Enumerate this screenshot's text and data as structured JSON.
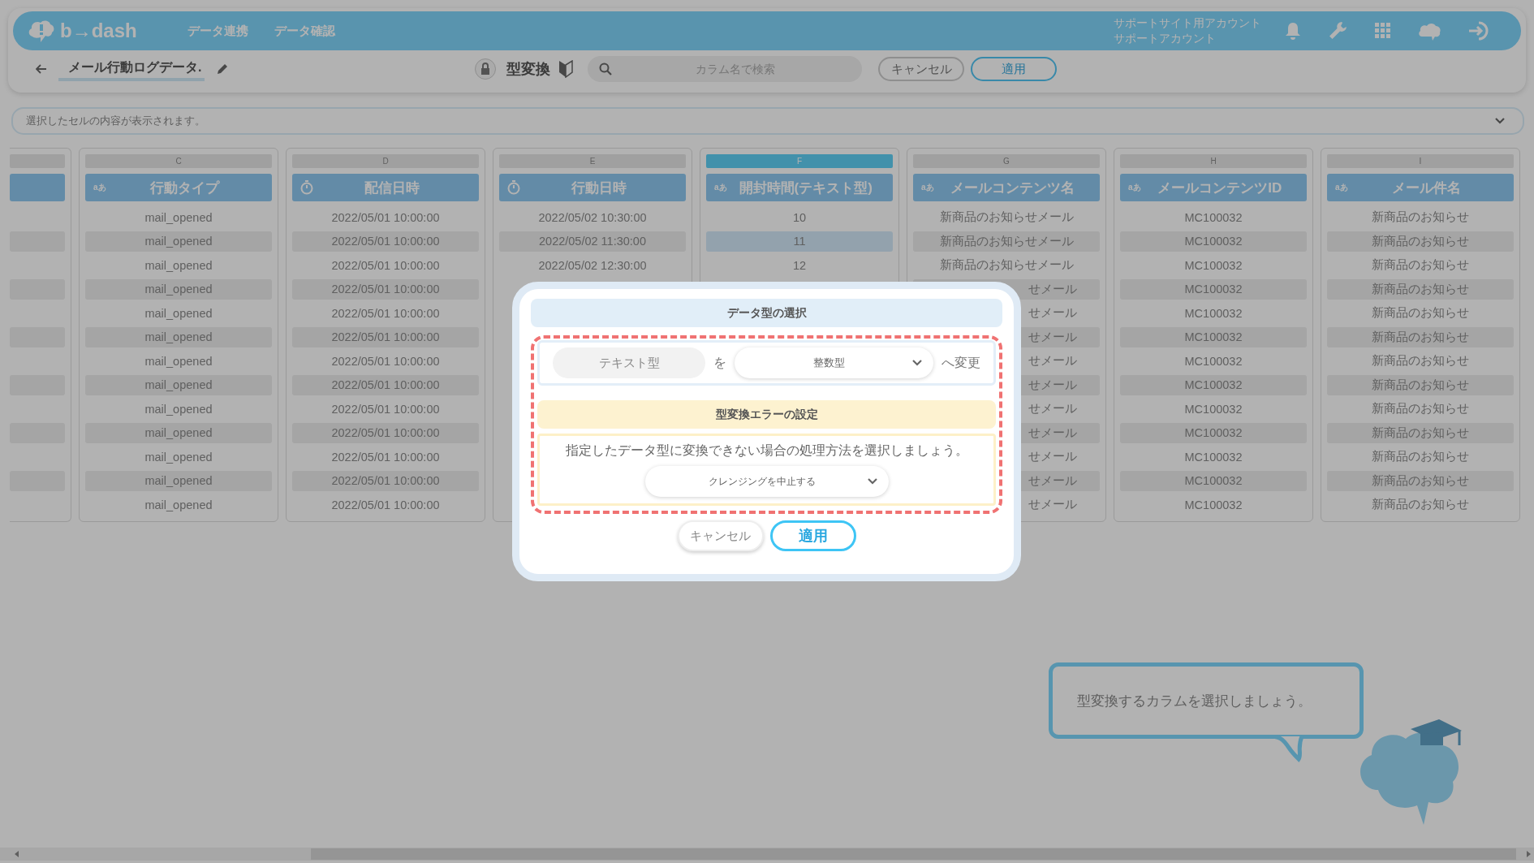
{
  "header": {
    "logo_text": "b→dash",
    "nav": [
      "データ連携",
      "データ確認"
    ],
    "account_lines": [
      "サポートサイト用アカウント",
      "サポートアカウント"
    ]
  },
  "toolbar": {
    "title": "メール行動ログデータ.",
    "mode_label": "型変換",
    "search": {
      "placeholder": "カラム名で検索"
    },
    "buttons": [
      {
        "label": "キャンセル",
        "kind": "secondary"
      },
      {
        "label": "適用",
        "kind": "primary"
      }
    ]
  },
  "cell_preview": {
    "placeholder": "選択したセルの内容が表示されます。"
  },
  "table": {
    "columns": [
      {
        "letter": "C",
        "name": "行動タイプ",
        "kind": "text",
        "type_mark": "aあ",
        "selected": false,
        "cells": [
          {
            "text": "mail_opened"
          },
          {
            "text": "mail_opened"
          },
          {
            "text": "mail_opened"
          },
          {
            "text": "mail_opened"
          },
          {
            "text": "mail_opened"
          },
          {
            "text": "mail_opened"
          },
          {
            "text": "mail_opened"
          },
          {
            "text": "mail_opened"
          },
          {
            "text": "mail_opened"
          },
          {
            "text": "mail_opened"
          },
          {
            "text": "mail_opened"
          },
          {
            "text": "mail_opened"
          },
          {
            "text": "mail_opened"
          }
        ]
      },
      {
        "letter": "D",
        "name": "配信日時",
        "kind": "datetime",
        "selected": false,
        "cells": [
          {
            "text": "2022/05/01 10:00:00"
          },
          {
            "text": "2022/05/01 10:00:00"
          },
          {
            "text": "2022/05/01 10:00:00"
          },
          {
            "text": "2022/05/01 10:00:00"
          },
          {
            "text": "2022/05/01 10:00:00"
          },
          {
            "text": "2022/05/01 10:00:00"
          },
          {
            "text": "2022/05/01 10:00:00"
          },
          {
            "text": "2022/05/01 10:00:00"
          },
          {
            "text": "2022/05/01 10:00:00"
          },
          {
            "text": "2022/05/01 10:00:00"
          },
          {
            "text": "2022/05/01 10:00:00"
          },
          {
            "text": "2022/05/01 10:00:00"
          },
          {
            "text": "2022/05/01 10:00:00"
          }
        ]
      },
      {
        "letter": "E",
        "name": "行動日時",
        "kind": "datetime",
        "selected": false,
        "cells": [
          {
            "text": "2022/05/02 10:30:00"
          },
          {
            "text": "2022/05/02 11:30:00"
          },
          {
            "text": "2022/05/02 12:30:00"
          }
        ]
      },
      {
        "letter": "F",
        "name": "開封時間(テキスト型)",
        "kind": "text",
        "type_mark": "aあ",
        "selected": true,
        "cells": [
          {
            "text": "10",
            "selected": false
          },
          {
            "text": "11",
            "selected": true
          },
          {
            "text": "12",
            "selected": false
          }
        ]
      },
      {
        "letter": "G",
        "name": "メールコンテンツ名",
        "kind": "text",
        "type_mark": "aあ",
        "selected": false,
        "cells": [
          {
            "text": "新商品のお知らせメール"
          },
          {
            "text": "新商品のお知らせメール"
          },
          {
            "text": "新商品のお知らせメール"
          },
          {
            "text": "せメール",
            "partial": true
          },
          {
            "text": "せメール",
            "partial": true
          },
          {
            "text": "せメール",
            "partial": true
          },
          {
            "text": "せメール",
            "partial": true
          },
          {
            "text": "せメール",
            "partial": true
          },
          {
            "text": "せメール",
            "partial": true
          },
          {
            "text": "せメール",
            "partial": true
          },
          {
            "text": "せメール",
            "partial": true
          },
          {
            "text": "せメール",
            "partial": true
          },
          {
            "text": "せメール",
            "partial": true
          }
        ]
      },
      {
        "letter": "H",
        "name": "メールコンテンツID",
        "kind": "text",
        "type_mark": "aあ",
        "selected": false,
        "cells": [
          {
            "text": "MC100032"
          },
          {
            "text": "MC100032"
          },
          {
            "text": "MC100032"
          },
          {
            "text": "MC100032"
          },
          {
            "text": "MC100032"
          },
          {
            "text": "MC100032"
          },
          {
            "text": "MC100032"
          },
          {
            "text": "MC100032"
          },
          {
            "text": "MC100032"
          },
          {
            "text": "MC100032"
          },
          {
            "text": "MC100032"
          },
          {
            "text": "MC100032"
          },
          {
            "text": "MC100032"
          }
        ]
      },
      {
        "letter": "I",
        "name": "メール件名",
        "kind": "text",
        "type_mark": "aあ",
        "selected": false,
        "cells": [
          {
            "text": "新商品のお知らせ"
          },
          {
            "text": "新商品のお知らせ"
          },
          {
            "text": "新商品のお知らせ"
          },
          {
            "text": "新商品のお知らせ"
          },
          {
            "text": "新商品のお知らせ"
          },
          {
            "text": "新商品のお知らせ"
          },
          {
            "text": "新商品のお知らせ"
          },
          {
            "text": "新商品のお知らせ"
          },
          {
            "text": "新商品のお知らせ"
          },
          {
            "text": "新商品のお知らせ"
          },
          {
            "text": "新商品のお知らせ"
          },
          {
            "text": "新商品のお知らせ"
          },
          {
            "text": "新商品のお知らせ"
          }
        ]
      }
    ]
  },
  "dialog": {
    "title": "データ型の選択",
    "from_type": "テキスト型",
    "particle": "を",
    "to_type": "整数型",
    "suffix": "へ変更",
    "error_title": "型変換エラーの設定",
    "error_text": "指定したデータ型に変換できない場合の処理方法を選択しましょう。",
    "error_option": "クレンジングを中止する",
    "buttons": [
      {
        "label": "キャンセル",
        "kind": "secondary"
      },
      {
        "label": "適用",
        "kind": "primary"
      }
    ]
  },
  "hint": {
    "text": "型変換するカラムを選択しましょう。"
  }
}
